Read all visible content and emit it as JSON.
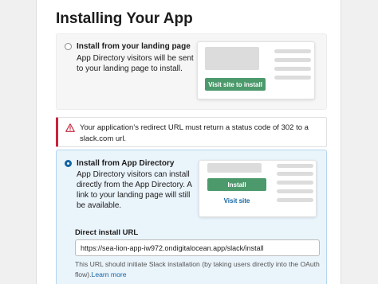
{
  "title": "Installing Your App",
  "landing_option": {
    "title": "Install from your landing page",
    "description_line1": "App Directory visitors will be sent",
    "description_line2": "to your landing page to install.",
    "preview_button": "Visit site to install"
  },
  "warning": {
    "icon": "warning-triangle-icon",
    "line1": "Your application’s redirect URL must return a status code of 302 to a",
    "line2": "slack.com url."
  },
  "directory_option": {
    "title": "Install from App Directory",
    "description_lines": [
      "App Directory visitors can install",
      "directly from the App Directory. A",
      "link to your landing page will still",
      "be available."
    ],
    "preview_install_button": "Install",
    "preview_visit_link": "Visit site"
  },
  "direct_install": {
    "label": "Direct install URL",
    "value": "https://sea-lion-app-iw972.ondigitalocean.app/slack/install",
    "helper_line1": "This URL should initiate Slack installation (by taking users directly into the OAuth",
    "helper_line2_prefix": "flow).",
    "learn_more": "Learn more"
  },
  "colors": {
    "accent_blue": "#1264a3",
    "install_green": "#4c9a6c",
    "warning_red": "#c8243c"
  }
}
